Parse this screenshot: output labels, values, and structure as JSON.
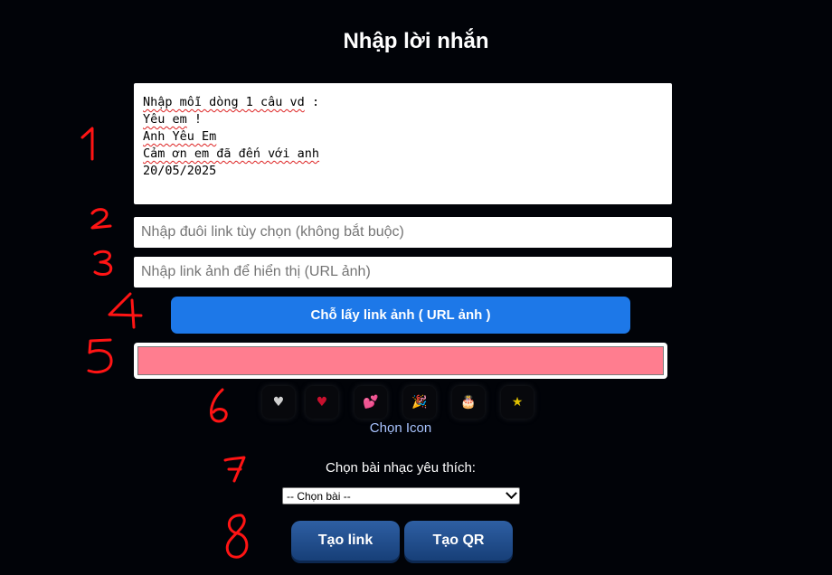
{
  "header": {
    "title": "Nhập lời nhắn"
  },
  "message_box": {
    "lines": [
      {
        "squiggly": "Nhập mỗi dòng 1 câu vd",
        "plain": " :"
      },
      {
        "squiggly": "Yêu em",
        "plain": " !"
      },
      {
        "squiggly": "Anh Yêu Em",
        "plain": ""
      },
      {
        "squiggly": "Cảm ơn em đã đến với anh",
        "plain": ""
      },
      {
        "squiggly": "",
        "plain": "20/05/2025"
      }
    ]
  },
  "inputs": {
    "link_suffix_placeholder": "Nhập đuôi link tùy chọn (không bắt buộc)",
    "image_url_placeholder": "Nhập link ảnh để hiển thị (URL ảnh)"
  },
  "buttons": {
    "get_image_link": "Chỗ lấy link ảnh ( URL ảnh )",
    "create_link": "Tạo link",
    "create_qr": "Tạo QR"
  },
  "color_picker": {
    "value": "#ff7d8f"
  },
  "icon_picker": {
    "icons": [
      {
        "name": "white-heart-icon",
        "glyph": "♥",
        "color": "#d0d0d0"
      },
      {
        "name": "red-heart-icon",
        "glyph": "♥",
        "color": "#c8102e"
      },
      {
        "name": "two-hearts-icon",
        "glyph": "💕",
        "color": "#d0204a"
      },
      {
        "name": "party-popper-icon",
        "glyph": "🎉",
        "color": "#e0a020"
      },
      {
        "name": "cake-icon",
        "glyph": "🎂",
        "color": "#a0704a"
      },
      {
        "name": "star-icon",
        "glyph": "★",
        "color": "#e0c000"
      }
    ],
    "label": "Chọn Icon"
  },
  "music": {
    "label": "Chọn bài nhạc yêu thích:",
    "selected": "-- Chọn bài --"
  },
  "annotations": [
    "1",
    "2",
    "3",
    "4",
    "5",
    "6",
    "7",
    "8"
  ],
  "colors": {
    "background": "#010308",
    "accent_blue": "#1d78e8",
    "annotation_red": "#ff1414"
  }
}
